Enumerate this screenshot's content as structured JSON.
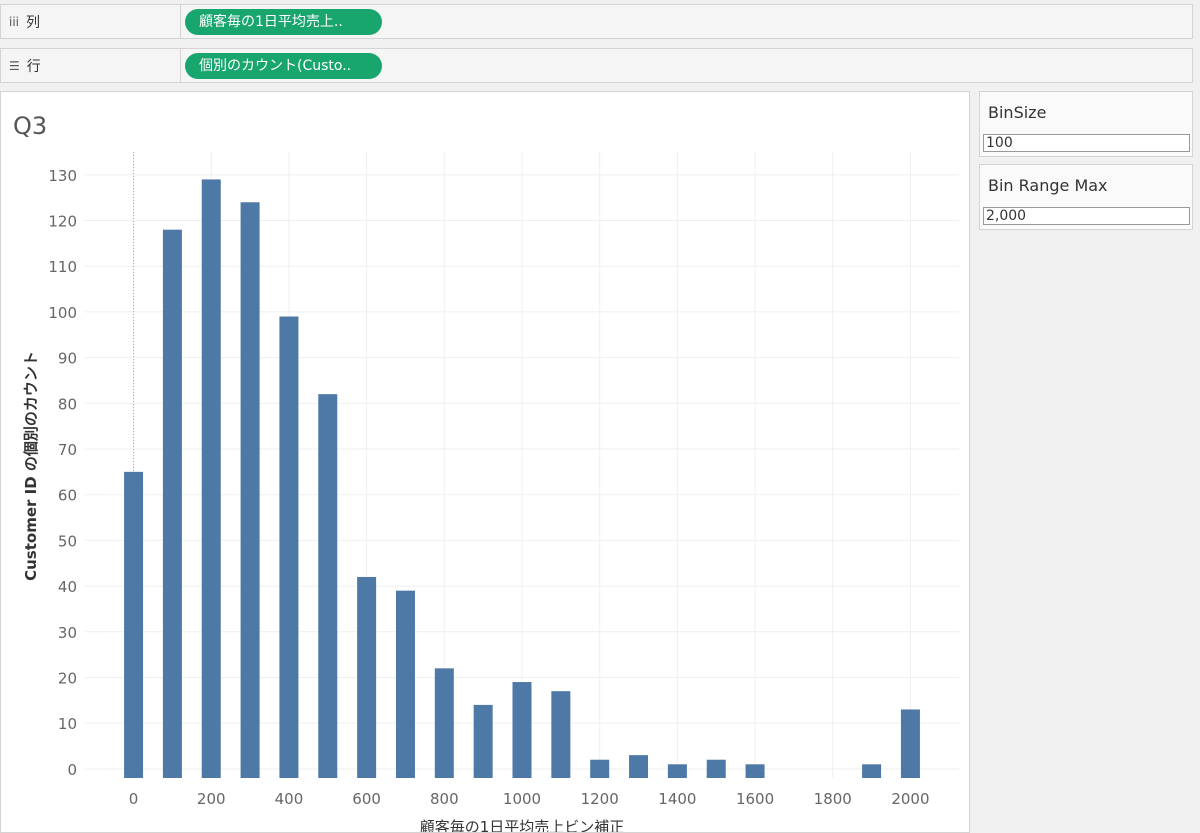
{
  "shelves": {
    "columns": {
      "icon": "columns-shelf-icon",
      "label": "列",
      "pill": "顧客毎の1日平均売上.."
    },
    "rows": {
      "icon": "rows-shelf-icon",
      "label": "行",
      "pill": "個別のカウント(Custo.."
    }
  },
  "sheet": {
    "title": "Q3"
  },
  "chart_data": {
    "type": "bar",
    "xlabel": "顧客毎の1日平均売上ビン補正",
    "ylabel": "Customer ID の個別のカウント",
    "x": [
      0,
      100,
      200,
      300,
      400,
      500,
      600,
      700,
      800,
      900,
      1000,
      1100,
      1200,
      1300,
      1400,
      1500,
      1600,
      1900,
      2000
    ],
    "values": [
      65,
      118,
      129,
      124,
      99,
      82,
      42,
      39,
      22,
      14,
      19,
      17,
      2,
      3,
      1,
      2,
      1,
      1,
      13
    ],
    "xlim": [
      -125,
      2125
    ],
    "ylim": [
      -2,
      135
    ],
    "xticks": [
      0,
      200,
      400,
      600,
      800,
      1000,
      1200,
      1400,
      1600,
      1800,
      2000
    ],
    "yticks": [
      0,
      10,
      20,
      30,
      40,
      50,
      60,
      70,
      80,
      90,
      100,
      110,
      120,
      130
    ],
    "grid": true,
    "bar_color": "#4e79a7"
  },
  "parameters": [
    {
      "title": "BinSize",
      "value": "100"
    },
    {
      "title": "Bin Range Max",
      "value": "2,000"
    }
  ]
}
